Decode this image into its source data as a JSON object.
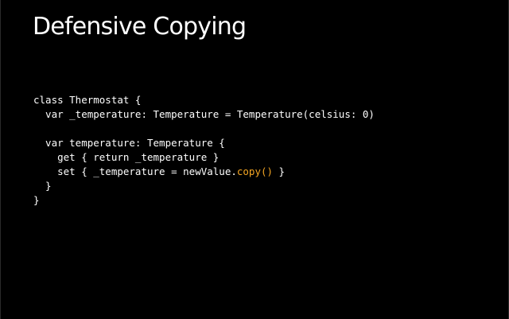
{
  "slide": {
    "title": "Defensive Copying",
    "accent_color": "#f5a623"
  },
  "code": {
    "lines": [
      {
        "before": "class Thermostat {",
        "highlight": "",
        "after": ""
      },
      {
        "before": "  var _temperature: Temperature = Temperature(celsius: 0)",
        "highlight": "",
        "after": ""
      },
      {
        "before": "",
        "highlight": "",
        "after": ""
      },
      {
        "before": "  var temperature: Temperature {",
        "highlight": "",
        "after": ""
      },
      {
        "before": "    get { return _temperature }",
        "highlight": "",
        "after": ""
      },
      {
        "before": "    set { _temperature = newValue.",
        "highlight": "copy()",
        "after": " }"
      },
      {
        "before": "  }",
        "highlight": "",
        "after": ""
      },
      {
        "before": "}",
        "highlight": "",
        "after": ""
      }
    ]
  }
}
